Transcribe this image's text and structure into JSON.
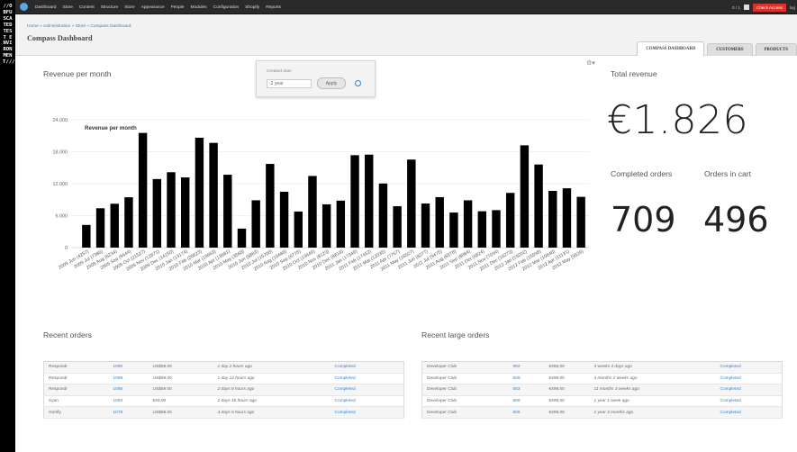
{
  "environment_label": "//OBFUSCATED TEST ENVIRONMENT///",
  "toolbar": {
    "menu": [
      "Dashboard",
      "Store",
      "Content",
      "Structure",
      "Store",
      "Appearance",
      "People",
      "Modules",
      "Configuration",
      "Shopify",
      "Reports"
    ],
    "counter": "0 / 1",
    "user_button": "Check Access",
    "logout": "log"
  },
  "breadcrumb": "Home » Administration » Store » Compass Dashboard",
  "page_title": "Compass Dashboard",
  "tabs": [
    {
      "label": "COMPASS DASHBOARD",
      "active": true
    },
    {
      "label": "CUSTOMERS",
      "active": false
    },
    {
      "label": "PRODUCTS",
      "active": false
    }
  ],
  "revenue_section": {
    "title": "Revenue per month"
  },
  "filter": {
    "label": "Created date",
    "value": "-2 year",
    "apply_label": "Apply"
  },
  "kpis": {
    "total_revenue_label": "Total revenue",
    "total_revenue_value": "€1.826",
    "completed_orders_label": "Completed orders",
    "completed_orders_value": "709",
    "orders_in_cart_label": "Orders in cart",
    "orders_in_cart_value": "496"
  },
  "chart_data": {
    "type": "bar",
    "title": "Revenue per month",
    "xlabel": "",
    "ylabel": "",
    "ylim": [
      0,
      24000
    ],
    "yticks": [
      "0",
      "6.000",
      "12.000",
      "18.000",
      "24.000"
    ],
    "grid": true,
    "bar_color": "#000000",
    "categories": [
      "2009 Jun (4257)",
      "2009 Jul (7386)",
      "2009 Aug (8234)",
      "2009 Sep (9444)",
      "2009 Oct (21527)",
      "2009 Nov (12871)",
      "2009 Dec (14150)",
      "2010 Jan (13174)",
      "2010 Feb (20623)",
      "2010 Mar (19663)",
      "2010 Apr (13681)",
      "2010 May (3568)",
      "2010 Jun (8883)",
      "2010 Jul (15708)",
      "2010 Aug (10486)",
      "2010 Sep (6775)",
      "2010 Oct (13449)",
      "2010 Nov (8123)",
      "2010 Dec (8818)",
      "2011 Jan (17349)",
      "2011 Feb (17452)",
      "2011 Mar (12035)",
      "2011 Apr (7767)",
      "2011 May (16527)",
      "2011 Jun (8277)",
      "2011 Jul (9475)",
      "2011 Aug (6578)",
      "2011 Sep (8884)",
      "2011 Oct (6824)",
      "2011 Nov (7034)",
      "2011 Dec (10273)",
      "2012 Jan (19202)",
      "2012 Feb (15598)",
      "2012 Mar (10648)",
      "2012 Apr (11131)",
      "2012 May (9529)"
    ],
    "series": [
      {
        "name": "Revenue per month",
        "values": [
          4257,
          7386,
          8234,
          9444,
          21527,
          12871,
          14150,
          13174,
          20623,
          19663,
          13681,
          3568,
          8883,
          15708,
          10486,
          6775,
          13449,
          8123,
          8818,
          17349,
          17452,
          12035,
          7767,
          16527,
          8277,
          9475,
          6578,
          8884,
          6824,
          7034,
          10273,
          19202,
          15598,
          10648,
          11131,
          9529
        ]
      }
    ]
  },
  "recent_orders": {
    "title": "Recent orders",
    "rows": [
      [
        "Respondr",
        "1090",
        "US$59.00",
        "1 day 2 hours ago",
        "Completed"
      ],
      [
        "Respondr",
        "1089",
        "US$59.00",
        "1 day 12 hours ago",
        "Completed"
      ],
      [
        "Respondr",
        "1086",
        "US$59.00",
        "2 days 8 hours ago",
        "Completed"
      ],
      [
        "Syan",
        "1083",
        "€49,00",
        "2 days 18 hours ago",
        "Completed"
      ],
      [
        "Genfly",
        "1078",
        "US$59.00",
        "4 days 6 hours ago",
        "Completed"
      ]
    ]
  },
  "recent_large_orders": {
    "title": "Recent large orders",
    "rows": [
      [
        "Developer Club",
        "992",
        "€369,00",
        "3 weeks 4 days ago",
        "Completed"
      ],
      [
        "Developer Club",
        "839",
        "€499,00",
        "4 months 2 weeks ago",
        "Completed"
      ],
      [
        "Developer Club",
        "683",
        "€499,00",
        "11 months 3 weeks ago",
        "Completed"
      ],
      [
        "Developer Club",
        "669",
        "€499,00",
        "1 year 1 week ago",
        "Completed"
      ],
      [
        "Developer Club",
        "606",
        "€499,00",
        "1 year 3 months ago",
        "Completed"
      ]
    ]
  }
}
